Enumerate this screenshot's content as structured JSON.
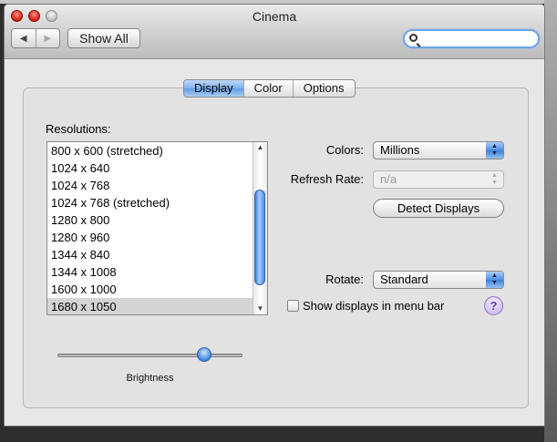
{
  "window": {
    "title": "Cinema"
  },
  "toolbar": {
    "back_icon": "back-arrow-icon",
    "forward_icon": "forward-arrow-icon",
    "show_all_label": "Show All",
    "search": {
      "value": "",
      "placeholder": ""
    }
  },
  "tabs": [
    {
      "label": "Display",
      "active": true
    },
    {
      "label": "Color",
      "active": false
    },
    {
      "label": "Options",
      "active": false
    }
  ],
  "resolutions": {
    "label": "Resolutions:",
    "items": [
      "800 x 600 (stretched)",
      "1024 x 640",
      "1024 x 768",
      "1024 x 768 (stretched)",
      "1280 x 800",
      "1280 x 960",
      "1344 x 840",
      "1344 x 1008",
      "1600 x 1000",
      "1680 x 1050"
    ],
    "selected_index": 9
  },
  "colors": {
    "label": "Colors:",
    "value": "Millions"
  },
  "refresh_rate": {
    "label": "Refresh Rate:",
    "value": "n/a",
    "enabled": false
  },
  "detect_displays": {
    "label": "Detect Displays"
  },
  "rotate": {
    "label": "Rotate:",
    "value": "Standard"
  },
  "show_in_menu_bar": {
    "label": "Show displays in menu bar",
    "checked": false
  },
  "help": {
    "label": "?"
  },
  "brightness": {
    "label": "Brightness",
    "level": 0.82
  },
  "colors_accent": {
    "accent": "#4e8fe2",
    "close_button": "#d21d10"
  }
}
